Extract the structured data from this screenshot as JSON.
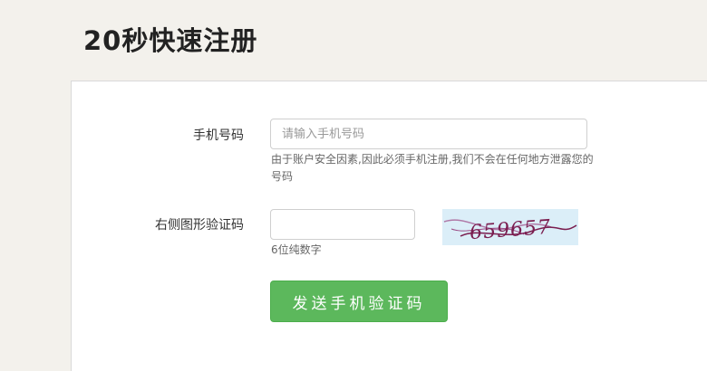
{
  "page": {
    "title": "20秒快速注册"
  },
  "form": {
    "phone": {
      "label": "手机号码",
      "placeholder": "请输入手机号码",
      "value": "",
      "hint": "由于账户安全因素,因此必须手机注册,我们不会在任何地方泄露您的号码"
    },
    "captcha": {
      "label": "右侧图形验证码",
      "value": "",
      "hint": "6位纯数字",
      "image_text": "659657"
    },
    "send_button_label": "发送手机验证码"
  },
  "colors": {
    "button": "#5cb85c",
    "captcha_bg": "#dbeef8",
    "captcha_text": "#7a1d4f"
  }
}
